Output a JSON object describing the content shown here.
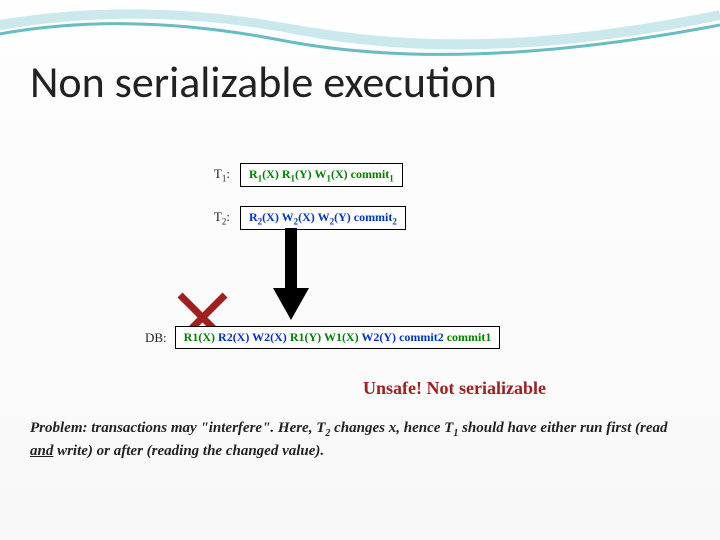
{
  "title": "Non serializable execution",
  "t1": {
    "label": "T",
    "sub": "1",
    "ops": "R₁(X)  R₁(Y)  W₁(X) commit₁"
  },
  "t2": {
    "label": "T",
    "sub": "2",
    "ops": "R₂(X) W₂(X) W₂(Y)  commit₂"
  },
  "db": {
    "label": "DB:",
    "seq": [
      {
        "txt": "R",
        "sub": "1",
        "arg": "(X) ",
        "cls": "green"
      },
      {
        "txt": "R",
        "sub": "2",
        "arg": "(X) ",
        "cls": "blue"
      },
      {
        "txt": "W",
        "sub": "2",
        "arg": "(X) ",
        "cls": "blue"
      },
      {
        "txt": "R",
        "sub": "1",
        "arg": "(Y) ",
        "cls": "green"
      },
      {
        "txt": "W",
        "sub": "1",
        "arg": "(X) ",
        "cls": "green"
      },
      {
        "txt": "W",
        "sub": "2",
        "arg": "(Y) ",
        "cls": "blue"
      },
      {
        "txt": "commit",
        "sub": "2",
        "arg": " ",
        "cls": "blue"
      },
      {
        "txt": "commit",
        "sub": "1",
        "arg": "",
        "cls": "green"
      }
    ]
  },
  "unsafe": "Unsafe!  Not serializable",
  "problem_pre": "Problem: transactions may \"interfere\".  Here, T",
  "problem_t2sub": "2",
  "problem_mid1": " changes x, hence T",
  "problem_t1sub": "1",
  "problem_mid2": " should have either run first (read ",
  "problem_and": "and",
  "problem_end": " write) or after (reading the changed value)."
}
